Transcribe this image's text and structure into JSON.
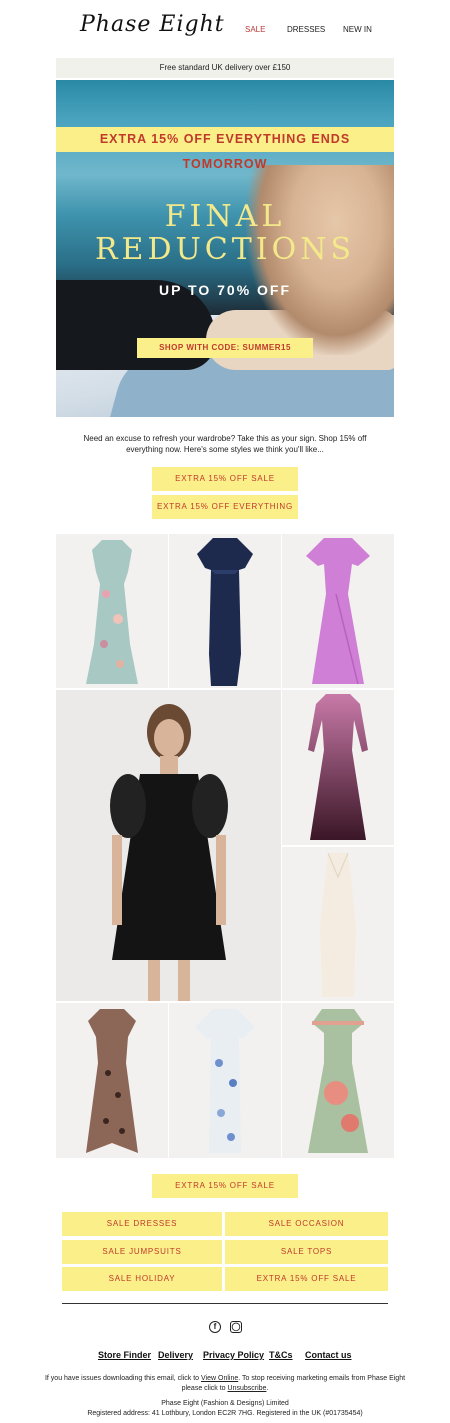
{
  "header": {
    "logo": "Phase Eight",
    "nav": [
      "SALE",
      "DRESSES",
      "NEW IN"
    ]
  },
  "delivery_bar": "Free standard UK delivery over £150",
  "hero": {
    "banner": "EXTRA 15% OFF EVERYTHING ENDS TOMORROW",
    "headline_line1": "FINAL",
    "headline_line2": "REDUCTIONS",
    "subhead": "UP TO 70% OFF",
    "code_button": "SHOP WITH CODE: SUMMER15"
  },
  "intro_text": "Need an excuse to refresh your wardrobe? Take this as your sign. Shop 15% off everything now. Here's some styles we think you'll like...",
  "cta_top": [
    "EXTRA 15% OFF SALE",
    "EXTRA 15% OFF EVERYTHING"
  ],
  "cta_middle": "EXTRA 15% OFF SALE",
  "category_buttons": [
    "SALE DRESSES",
    "SALE OCCASION",
    "SALE JUMPSUITS",
    "SALE TOPS",
    "SALE HOLIDAY",
    "EXTRA 15% OFF SALE"
  ],
  "social_icons": [
    "facebook-icon",
    "instagram-icon"
  ],
  "footer_links": [
    "Store Finder",
    "Delivery",
    "Privacy Policy",
    "T&Cs",
    "Contact us"
  ],
  "footer": {
    "issues_pre": "If you have issues downloading this email, click to",
    "view_online": "View Online",
    "issues_mid": ". To stop receiving marketing emails from Phase Eight please click to",
    "unsubscribe": "Unsubscribe",
    "company": "Phase Eight (Fashion & Designs) Limited",
    "address": "Registered address: 41 Lothbury, London EC2R 7HG. Registered in the UK (#01735454)"
  },
  "colors": {
    "accent_yellow": "#fbef8a",
    "accent_red": "#c0392b"
  }
}
